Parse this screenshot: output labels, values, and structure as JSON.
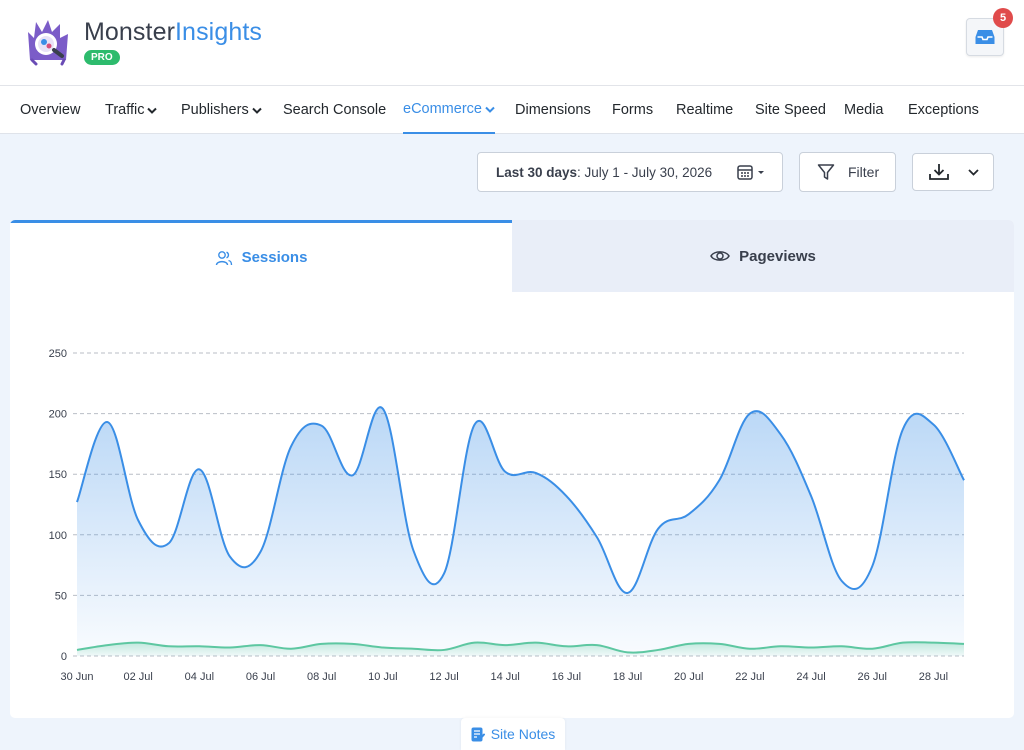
{
  "brand": {
    "name_part1": "Monster",
    "name_part2": "Insights",
    "badge": "PRO"
  },
  "notifications": {
    "count": "5",
    "icon": "inbox-icon"
  },
  "nav": {
    "items": [
      {
        "label": "Overview",
        "dropdown": false,
        "active": false
      },
      {
        "label": "Traffic",
        "dropdown": true,
        "active": false
      },
      {
        "label": "Publishers",
        "dropdown": true,
        "active": false
      },
      {
        "label": "Search Console",
        "dropdown": false,
        "active": false
      },
      {
        "label": "eCommerce",
        "dropdown": true,
        "active": true
      },
      {
        "label": "Dimensions",
        "dropdown": false,
        "active": false
      },
      {
        "label": "Forms",
        "dropdown": false,
        "active": false
      },
      {
        "label": "Realtime",
        "dropdown": false,
        "active": false
      },
      {
        "label": "Site Speed",
        "dropdown": false,
        "active": false
      },
      {
        "label": "Media",
        "dropdown": false,
        "active": false
      },
      {
        "label": "Exceptions",
        "dropdown": false,
        "active": false
      }
    ]
  },
  "controls": {
    "date_range_label": "Last 30 days",
    "date_range_value": ": July 1 - July 30, 2026",
    "filter_label": "Filter"
  },
  "tabs": {
    "sessions": "Sessions",
    "pageviews": "Pageviews"
  },
  "site_notes": "Site Notes",
  "colors": {
    "accent": "#3a8ee6",
    "secondary_series": "#5dc7a1",
    "active_tab": "#3a8ee6"
  },
  "chart_data": {
    "type": "area",
    "ylim": [
      0,
      250
    ],
    "yticks": [
      0,
      50,
      100,
      150,
      200,
      250
    ],
    "x": [
      "30 Jun",
      "01 Jul",
      "02 Jul",
      "03 Jul",
      "04 Jul",
      "05 Jul",
      "06 Jul",
      "07 Jul",
      "08 Jul",
      "09 Jul",
      "10 Jul",
      "11 Jul",
      "12 Jul",
      "13 Jul",
      "14 Jul",
      "15 Jul",
      "16 Jul",
      "17 Jul",
      "18 Jul",
      "19 Jul",
      "20 Jul",
      "21 Jul",
      "22 Jul",
      "23 Jul",
      "24 Jul",
      "25 Jul",
      "26 Jul",
      "27 Jul",
      "28 Jul",
      "29 Jul"
    ],
    "xtick_labels": [
      "30 Jun",
      "02 Jul",
      "04 Jul",
      "06 Jul",
      "08 Jul",
      "10 Jul",
      "12 Jul",
      "14 Jul",
      "16 Jul",
      "18 Jul",
      "20 Jul",
      "22 Jul",
      "24 Jul",
      "26 Jul",
      "28 Jul"
    ],
    "series": [
      {
        "values": [
          127,
          193,
          112,
          93,
          154,
          82,
          86,
          173,
          190,
          149,
          204,
          87,
          68,
          191,
          152,
          151,
          132,
          98,
          52,
          105,
          117,
          145,
          200,
          183,
          132,
          62,
          74,
          187,
          191,
          145
        ]
      },
      {
        "values": [
          5,
          9,
          11,
          8,
          8,
          7,
          9,
          6,
          10,
          10,
          7,
          6,
          5,
          11,
          9,
          11,
          8,
          9,
          3,
          5,
          10,
          10,
          6,
          8,
          7,
          8,
          6,
          11,
          11,
          10
        ]
      }
    ]
  }
}
